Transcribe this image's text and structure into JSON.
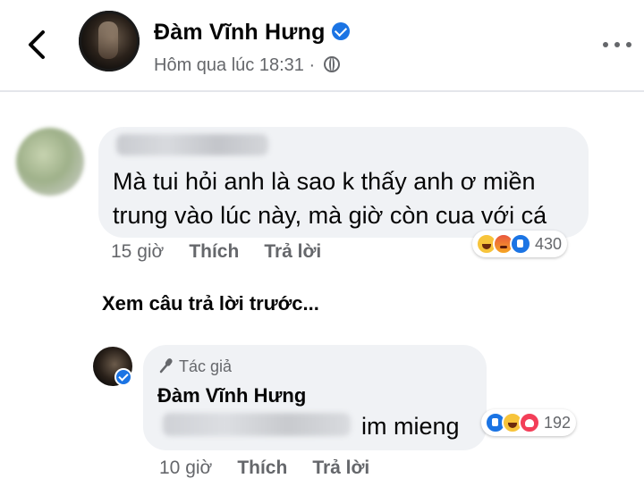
{
  "header": {
    "author": "Đàm Vĩnh Hưng",
    "timestamp": "Hôm qua lúc 18:31 ·"
  },
  "comment": {
    "text": "Mà tui hỏi anh là sao k thấy anh ơ miền trung vào lúc này, mà giờ còn cua với cá",
    "time": "15 giờ",
    "like_label": "Thích",
    "reply_label": "Trả lời",
    "reactions": [
      "haha-icon",
      "angry-icon",
      "like-icon"
    ],
    "reaction_count": "430"
  },
  "view_previous": "Xem câu trả lời trước...",
  "reply": {
    "badge": "Tác giả",
    "name": "Đàm Vĩnh Hưng",
    "text": "im mieng",
    "time": "10 giờ",
    "like_label": "Thích",
    "reply_label": "Trả lời",
    "reactions": [
      "like-icon",
      "haha-icon",
      "love-icon"
    ],
    "reaction_count": "192"
  },
  "colors": {
    "verified_blue": "#1b74e4",
    "bubble_bg": "#f0f2f5",
    "secondary_text": "#65676b"
  }
}
